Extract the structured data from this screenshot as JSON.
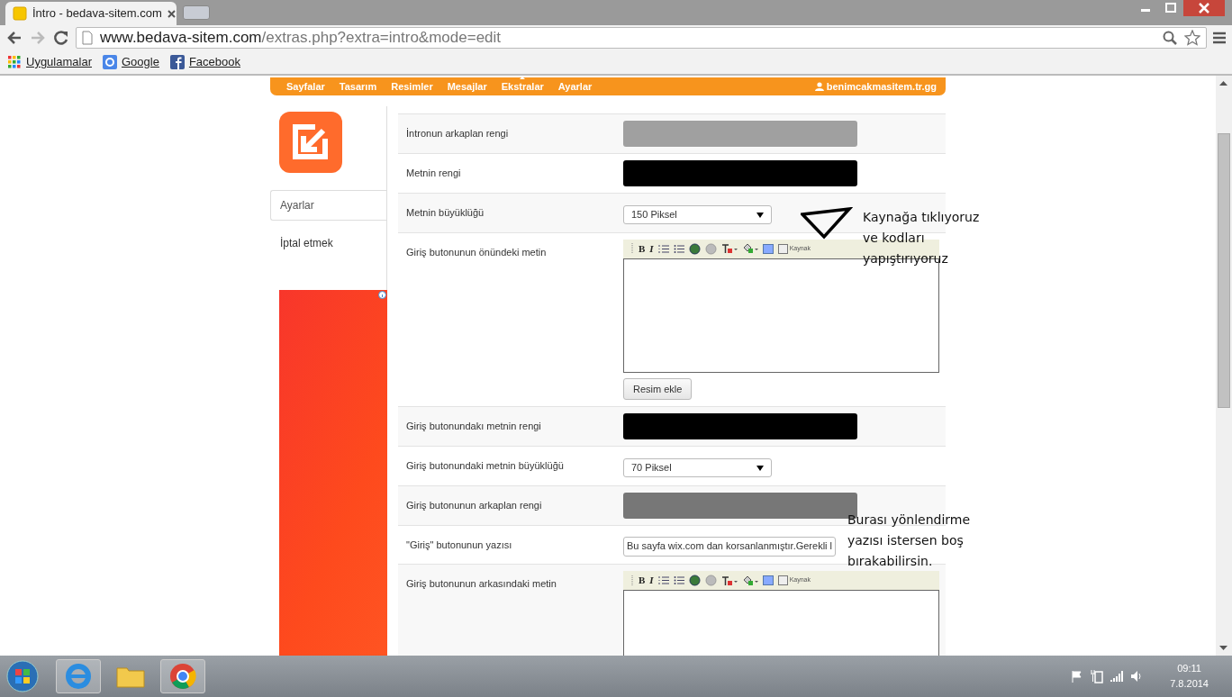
{
  "browser": {
    "tabs": [
      {
        "title": "İntro - bedava-sitem.com",
        "selected": true
      }
    ],
    "address": {
      "host": "www.bedava-sitem.com",
      "path": "/extras.php?extra=intro&mode=edit"
    },
    "bookmarks": [
      {
        "label": "Uygulamalar",
        "kind": "apps"
      },
      {
        "label": "Google",
        "kind": "google"
      },
      {
        "label": "Facebook",
        "kind": "facebook"
      }
    ]
  },
  "nav": {
    "items": [
      {
        "label": "Sayfalar",
        "selected": false
      },
      {
        "label": "Tasarım",
        "selected": false
      },
      {
        "label": "Resimler",
        "selected": false
      },
      {
        "label": "Mesajlar",
        "selected": false
      },
      {
        "label": "Ekstralar",
        "selected": true
      },
      {
        "label": "Ayarlar",
        "selected": false
      }
    ],
    "user": "benimcakmasitem.tr.gg"
  },
  "sidebar": {
    "items": [
      {
        "label": "Ayarlar",
        "selected": true
      },
      {
        "label": "İptal etmek",
        "selected": false
      }
    ]
  },
  "form": {
    "rows": [
      {
        "label": "İntronun arkaplan rengi",
        "kind": "color",
        "color": "#a0a0a0"
      },
      {
        "label": "Metnin rengi",
        "kind": "color",
        "color": "#000000"
      },
      {
        "label": "Metnin büyüklüğü",
        "kind": "select",
        "value": "150 Piksel"
      },
      {
        "label": "Giriş butonunun önündeki metin",
        "kind": "editor",
        "bold": "B",
        "italic": "I",
        "source": "Kaynak",
        "button": "Resim ekle"
      },
      {
        "label": "Giriş butonundakı metnin rengi",
        "kind": "color",
        "color": "#000000"
      },
      {
        "label": "Giriş butonundaki metnin büyüklüğü",
        "kind": "select",
        "value": "70 Piksel"
      },
      {
        "label": "Giriş butonunun arkaplan rengi",
        "kind": "color",
        "color": "#777777"
      },
      {
        "label": "\"Giriş\" butonunun yazısı",
        "kind": "text",
        "value": "Bu sayfa wix.com dan korsanlanmıştır.Gerekli l"
      },
      {
        "label": "Giriş butonunun arkasındaki metin",
        "kind": "editor",
        "bold": "B",
        "italic": "I",
        "source": "Kaynak"
      }
    ]
  },
  "annotations": [
    {
      "lines": [
        "Kaynağa tıklıyoruz",
        "ve kodları",
        "yapıştırıyoruz"
      ],
      "arrow": true
    },
    {
      "lines": [
        "Burası yönlendirme",
        "yazısı istersen boş",
        "bırakabilirsin."
      ],
      "arrow": false
    }
  ],
  "taskbar": {
    "time": "09:11",
    "date": "7.8.2014"
  }
}
